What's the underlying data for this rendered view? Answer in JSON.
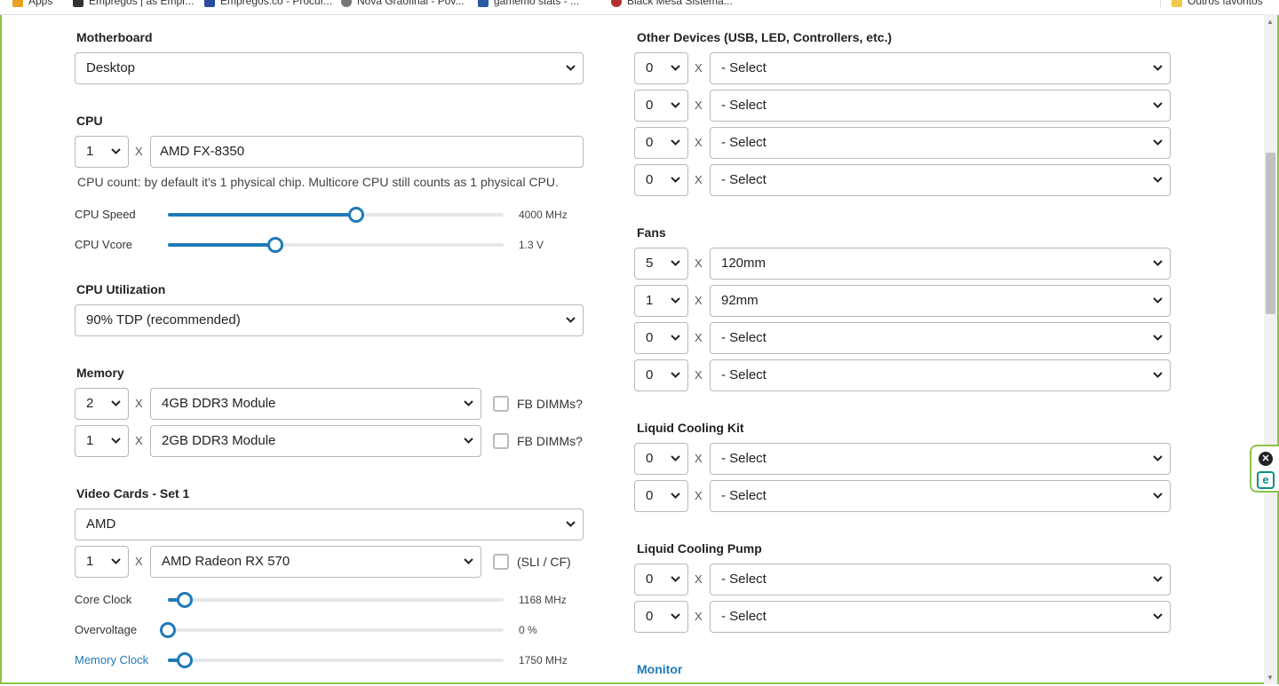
{
  "bookmarks": [
    {
      "label": "Apps",
      "color": "#e8a21c"
    },
    {
      "label": "Empregos | as Empr...",
      "color": "#333333"
    },
    {
      "label": "Empregos.co - Procur...",
      "color": "#2a4d9b"
    },
    {
      "label": "Nova Grãofinal - Pov...",
      "color": "#777777"
    },
    {
      "label": "gamemo stats - ...",
      "color": "#2a5aa0"
    },
    {
      "label": "Black Mesa Sistema...",
      "color": "#b03030"
    },
    {
      "label": "Outros favoritos",
      "color": "#f2c94c"
    }
  ],
  "left": {
    "motherboard": {
      "label": "Motherboard",
      "value": "Desktop"
    },
    "cpu": {
      "label": "CPU",
      "count": "1",
      "x": "X",
      "model": "AMD FX-8350",
      "note": "CPU count: by default it's 1 physical chip. Multicore CPU still counts as 1 physical CPU.",
      "speed": {
        "label": "CPU Speed",
        "value": "4000 MHz",
        "level": 0.56
      },
      "vcore": {
        "label": "CPU Vcore",
        "value": "1.3 V",
        "level": 0.32
      }
    },
    "utilization": {
      "label": "CPU Utilization",
      "value": "90% TDP (recommended)"
    },
    "memory": {
      "label": "Memory",
      "rows": [
        {
          "count": "2",
          "x": "X",
          "module": "4GB DDR3 Module",
          "fb": "FB DIMMs?"
        },
        {
          "count": "1",
          "x": "X",
          "module": "2GB DDR3 Module",
          "fb": "FB DIMMs?"
        }
      ]
    },
    "video": {
      "label": "Video Cards - Set 1",
      "brand": "AMD",
      "count": "1",
      "x": "X",
      "model": "AMD Radeon RX 570",
      "sli": "(SLI / CF)",
      "core": {
        "label": "Core Clock",
        "value": "1168 MHz",
        "level": 0.05
      },
      "overvolt": {
        "label": "Overvoltage",
        "value": "0 %",
        "level": 0.0
      },
      "memclock": {
        "label": "Memory Clock",
        "value": "1750 MHz",
        "level": 0.05
      }
    }
  },
  "right": {
    "other": {
      "label": "Other Devices (USB, LED, Controllers, etc.)",
      "rows": [
        {
          "count": "0",
          "x": "X",
          "value": "- Select"
        },
        {
          "count": "0",
          "x": "X",
          "value": "- Select"
        },
        {
          "count": "0",
          "x": "X",
          "value": "- Select"
        },
        {
          "count": "0",
          "x": "X",
          "value": "- Select"
        }
      ]
    },
    "fans": {
      "label": "Fans",
      "rows": [
        {
          "count": "5",
          "x": "X",
          "value": "120mm"
        },
        {
          "count": "1",
          "x": "X",
          "value": "92mm"
        },
        {
          "count": "0",
          "x": "X",
          "value": "- Select"
        },
        {
          "count": "0",
          "x": "X",
          "value": "- Select"
        }
      ]
    },
    "liquidkit": {
      "label": "Liquid Cooling Kit",
      "rows": [
        {
          "count": "0",
          "x": "X",
          "value": "- Select"
        },
        {
          "count": "0",
          "x": "X",
          "value": "- Select"
        }
      ]
    },
    "liquidpump": {
      "label": "Liquid Cooling Pump",
      "rows": [
        {
          "count": "0",
          "x": "X",
          "value": "- Select"
        },
        {
          "count": "0",
          "x": "X",
          "value": "- Select"
        }
      ]
    },
    "monitor": {
      "label": "Monitor"
    }
  },
  "widget": {
    "close_glyph": "✕",
    "logo_glyph": "e"
  },
  "colors": {
    "accent": "#1f7ab8",
    "frame": "#8bc34a"
  }
}
